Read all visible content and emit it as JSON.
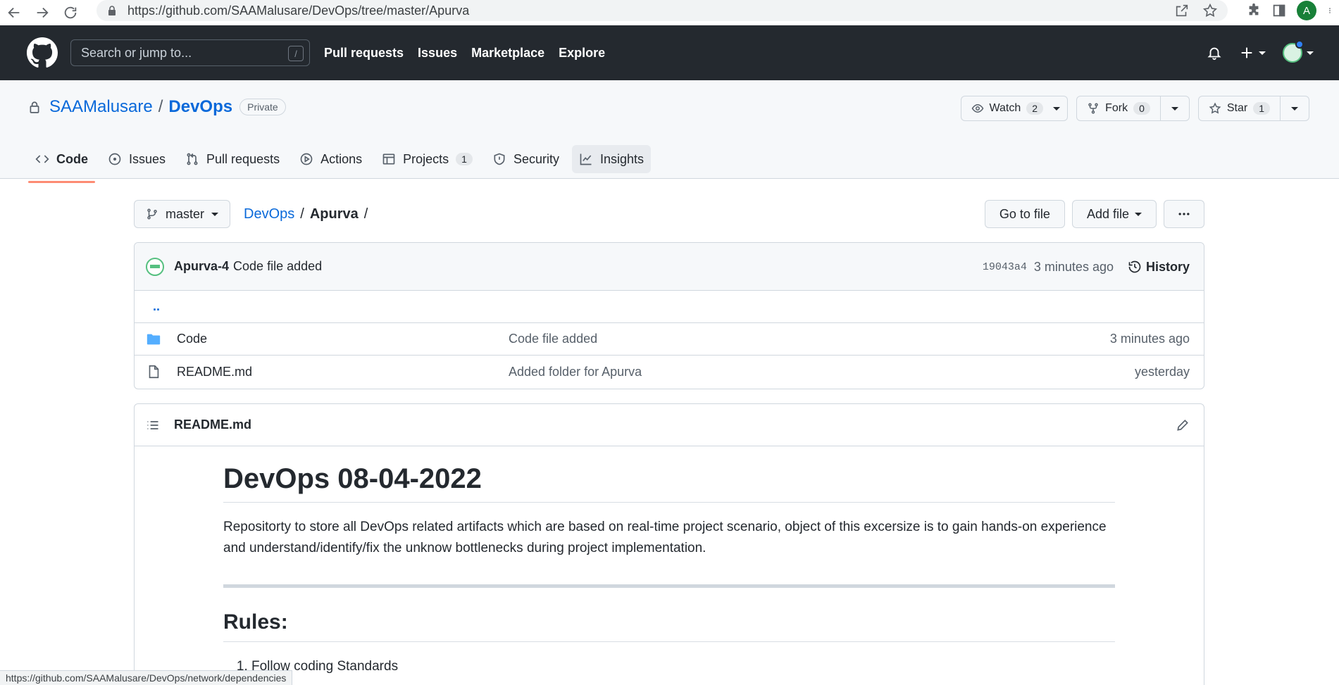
{
  "browser": {
    "url": "https://github.com/SAAMalusare/DevOps/tree/master/Apurva",
    "profile_initial": "A"
  },
  "header": {
    "search_placeholder": "Search or jump to...",
    "search_shortcut": "/",
    "nav": [
      "Pull requests",
      "Issues",
      "Marketplace",
      "Explore"
    ]
  },
  "repo": {
    "owner": "SAAMalusare",
    "separator": "/",
    "name": "DevOps",
    "visibility": "Private",
    "watch": {
      "label": "Watch",
      "count": "2"
    },
    "fork": {
      "label": "Fork",
      "count": "0"
    },
    "star": {
      "label": "Star",
      "count": "1"
    }
  },
  "tabs": [
    {
      "label": "Code",
      "icon": "code-icon"
    },
    {
      "label": "Issues",
      "icon": "issue-icon"
    },
    {
      "label": "Pull requests",
      "icon": "pull-request-icon"
    },
    {
      "label": "Actions",
      "icon": "play-icon"
    },
    {
      "label": "Projects",
      "icon": "table-icon",
      "count": "1"
    },
    {
      "label": "Security",
      "icon": "shield-icon"
    },
    {
      "label": "Insights",
      "icon": "graph-icon"
    }
  ],
  "file_nav": {
    "branch": "master",
    "crumb_repo": "DevOps",
    "crumb_sep": "/",
    "crumb_folder": "Apurva",
    "crumb_trail": "/",
    "go_to_file": "Go to file",
    "add_file": "Add file"
  },
  "commit": {
    "author": "Apurva-4",
    "message": "Code file added",
    "sha": "19043a4",
    "time": "3 minutes ago",
    "history": "History"
  },
  "parent_dir": "..",
  "files": [
    {
      "name": "Code",
      "type": "folder",
      "message": "Code file added",
      "time": "3 minutes ago"
    },
    {
      "name": "README.md",
      "type": "file",
      "message": "Added folder for Apurva",
      "time": "yesterday"
    }
  ],
  "readme": {
    "filename": "README.md",
    "title": "DevOps 08-04-2022",
    "paragraph": "Repositorty to store all DevOps related artifacts which are based on real-time project scenario, object of this excersize is to gain hands-on experience and understand/identify/fix the unknow bottlenecks during project implementation.",
    "rules_heading": "Rules:",
    "rules": [
      "Follow coding Standards"
    ]
  },
  "status_url": "https://github.com/SAAMalusare/DevOps/network/dependencies",
  "colors": {
    "header_bg": "#24292f",
    "link": "#0969da",
    "tab_underline": "#fd8c73",
    "folder": "#54aeff"
  }
}
